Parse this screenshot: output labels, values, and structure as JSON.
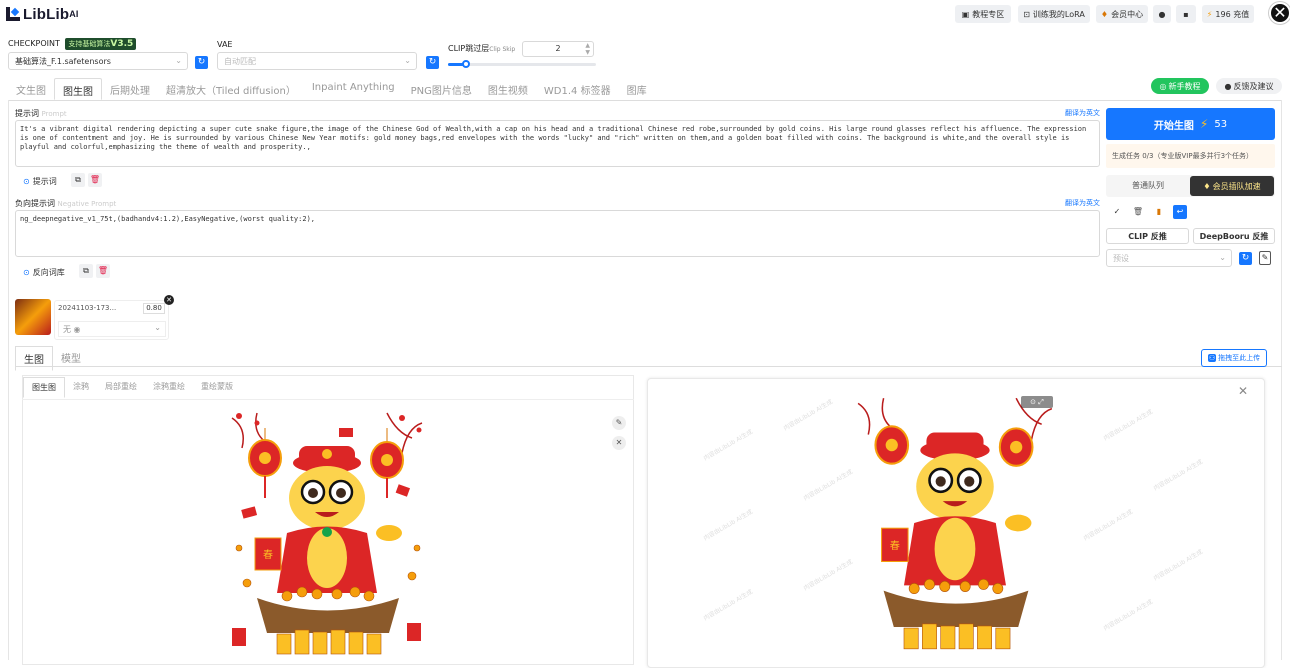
{
  "topbar": {
    "logo_text": "LibLib",
    "logo_ai": "AI",
    "tutorial": "教程专区",
    "train_lora": "训练我的LoRA",
    "vip_center": "会员中心",
    "credits": "196 充值"
  },
  "model": {
    "checkpoint_label": "CHECKPOINT",
    "checkpoint_badge": "支持基础算法",
    "checkpoint_version": "V3.5",
    "checkpoint_value": "基础算法_F.1.safetensors",
    "vae_label": "VAE",
    "vae_placeholder": "自动匹配",
    "clip_label": "CLIP跳过层",
    "clip_sub": "Clip Skip",
    "clip_value": "2",
    "clip_slider_fraction": 0.12
  },
  "tabs": [
    "文生图",
    "图生图",
    "后期处理",
    "超清放大（Tiled diffusion）",
    "Inpaint Anything",
    "PNG图片信息",
    "图生视频",
    "WD1.4 标签器",
    "图库"
  ],
  "active_tab_index": 1,
  "prompt": {
    "label": "提示词",
    "label_en": "Prompt",
    "translate": "翻译为英文",
    "text": "It's a vibrant digital rendering depicting a super cute snake figure,the image of the Chinese God of Wealth,with a cap on his head and a traditional Chinese red robe,surrounded by gold coins. His large round glasses reflect his affluence. The expression is one of contentment and joy. He is surrounded by various Chinese New Year motifs: gold money bags,red envelopes with the words \"lucky\" and \"rich\" written on them,and a golden boat filled with coins. The background is white,and the overall style is playful and colorful,emphasizing the theme of wealth and prosperity.,",
    "tool_label": "提示词"
  },
  "negative": {
    "label": "负向提示词",
    "label_en": "Negative Prompt",
    "translate": "翻译为英文",
    "text": "ng_deepnegative_v1_75t,(badhandv4:1.2),EasyNegative,(worst quality:2),",
    "tool_label": "反向词库"
  },
  "lora": {
    "name": "20241103-173...",
    "weight": "0.80",
    "select_value": "无"
  },
  "section_tabs": [
    "生图",
    "模型"
  ],
  "upload_label": "拖拽至此上传",
  "image_subtabs": [
    "图生图",
    "涂鸦",
    "局部重绘",
    "涂鸦重绘",
    "重绘蒙版"
  ],
  "right": {
    "new_tutorial": "新手教程",
    "feedback": "反馈及建议",
    "generate": "开始生图",
    "generate_cost": "53",
    "task_info": "生成任务 0/3（专业版VIP最多并行3个任务）",
    "queue_normal": "普通队列",
    "queue_vip": "会员插队加速",
    "clip_reverse": "CLIP 反推",
    "deepbooru_reverse": "DeepBooru 反推",
    "preset_placeholder": "预设"
  },
  "watermark_text": "内容由LibLib AI生成",
  "colors": {
    "accent": "#1677ff",
    "green_badge": "#1f4d2c",
    "tutorial_green": "#22c55e"
  }
}
